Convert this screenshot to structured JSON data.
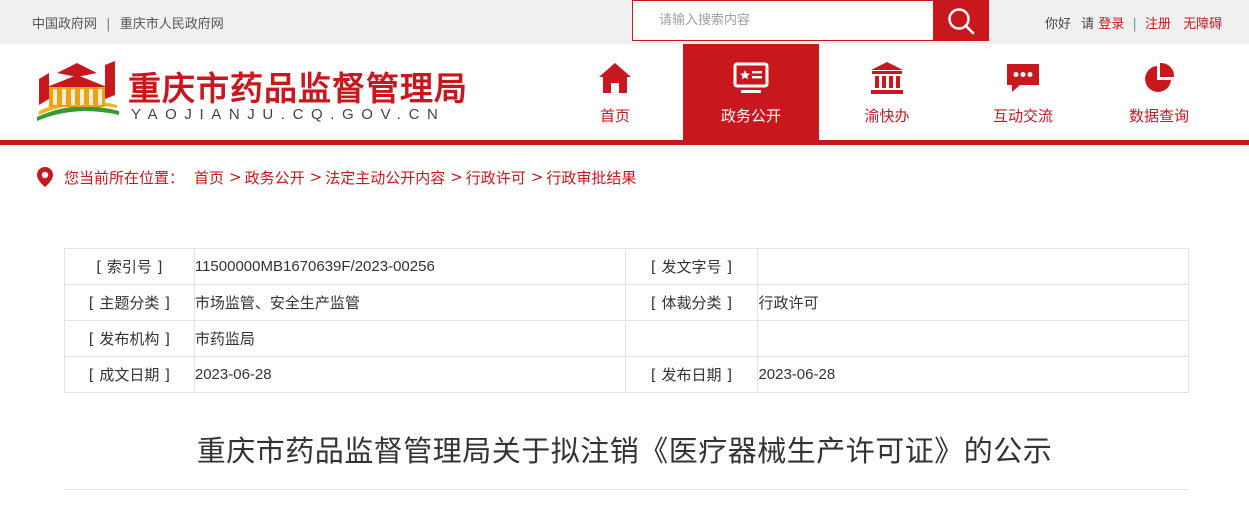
{
  "topbar": {
    "link1": "中国政府网",
    "separator": "|",
    "link2": "重庆市人民政府网",
    "search_placeholder": "请输入搜索内容",
    "greeting": "你好",
    "please": "请",
    "login": "登录",
    "register": "注册",
    "accessibility": "无障碍"
  },
  "header": {
    "title": "重庆市药品监督管理局",
    "domain": "YAOJIANJU.CQ.GOV.CN",
    "nav": [
      {
        "label": "首页",
        "icon": "home-icon"
      },
      {
        "label": "政务公开",
        "icon": "monitor-star-icon"
      },
      {
        "label": "渝快办",
        "icon": "building-icon"
      },
      {
        "label": "互动交流",
        "icon": "chat-icon"
      },
      {
        "label": "数据查询",
        "icon": "pie-chart-icon"
      }
    ],
    "active_index": 1
  },
  "breadcrumb": {
    "prefix": "您当前所在位置：",
    "items": [
      "首页",
      "政务公开",
      "法定主动公开内容",
      "行政许可",
      "行政审批结果"
    ],
    "arrow": ">"
  },
  "info": {
    "index_label": "[ 索引号 ]",
    "index_value": "11500000MB1670639F/2023-00256",
    "docno_label": "[ 发文字号 ]",
    "docno_value": "",
    "topic_label": "[ 主题分类 ]",
    "topic_value": "市场监管、安全生产监管",
    "genre_label": "[ 体裁分类 ]",
    "genre_value": "行政许可",
    "issuer_label": "[ 发布机构 ]",
    "issuer_value": "市药监局",
    "created_label": "[ 成文日期 ]",
    "created_value": "2023-06-28",
    "published_label": "[ 发布日期 ]",
    "published_value": "2023-06-28"
  },
  "document": {
    "title": "重庆市药品监督管理局关于拟注销《医疗器械生产许可证》的公示"
  },
  "colors": {
    "brand_red": "#c9171e",
    "topbar_bg": "#f0f0f0"
  }
}
